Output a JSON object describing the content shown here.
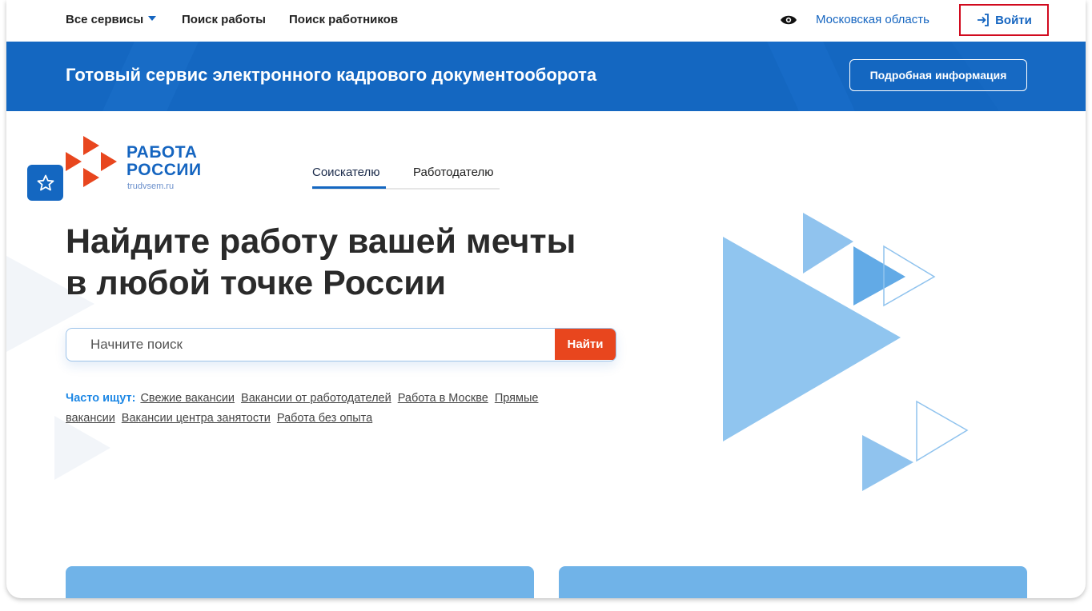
{
  "topnav": {
    "all_services": "Все сервисы",
    "job_search": "Поиск работы",
    "worker_search": "Поиск работников",
    "region": "Московская область",
    "login": "Войти"
  },
  "banner": {
    "title": "Готовый сервис электронного кадрового документооборота",
    "button": "Подробная информация"
  },
  "logo": {
    "line1": "РАБОТА",
    "line2": "РОССИИ",
    "url": "trudvsem.ru"
  },
  "tabs": {
    "seeker": "Соискателю",
    "employer": "Работодателю"
  },
  "hero": {
    "line1": "Найдите работу вашей мечты",
    "line2": "в любой точке России"
  },
  "search": {
    "placeholder": "Начните поиск",
    "button": "Найти"
  },
  "frequent": {
    "label": "Часто ищут:",
    "links": [
      "Свежие вакансии",
      "Вакансии от работодателей",
      "Работа в Москве",
      "Прямые вакансии",
      "Вакансии центра занятости",
      "Работа без опыта"
    ]
  },
  "colors": {
    "brand_blue": "#1467c1",
    "accent_orange": "#e8461e",
    "login_highlight": "#d10a1e"
  },
  "icons": [
    "chevron-down-icon",
    "eye-icon",
    "login-icon",
    "star-icon",
    "logo-triangles-icon"
  ]
}
